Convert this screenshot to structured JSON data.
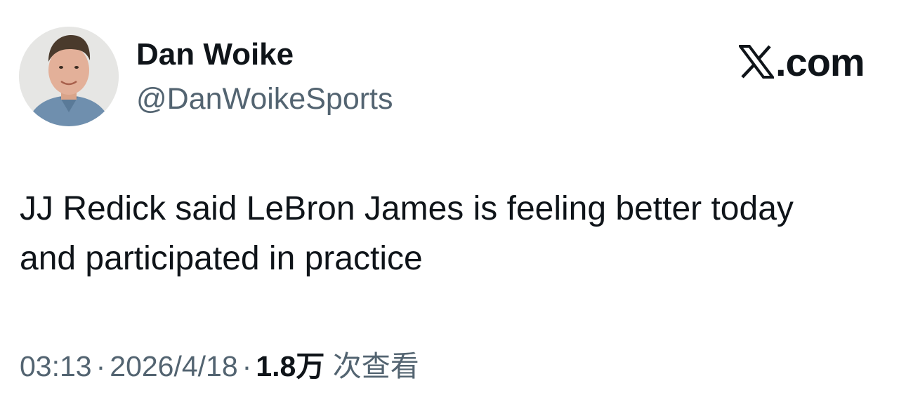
{
  "author": {
    "display_name": "Dan Woike",
    "handle": "@DanWoikeSports"
  },
  "brand": {
    "domain": ".com",
    "icon": "x-logo-icon"
  },
  "tweet": {
    "text_line_1": "JJ Redick said LeBron James is feeling better today",
    "text_line_2": "and participated in practice"
  },
  "meta": {
    "time": "03:13",
    "separator": "·",
    "date": "2026/4/18",
    "views_count": "1.8万",
    "views_label": "次查看"
  },
  "colors": {
    "text_primary": "#0f1419",
    "text_secondary": "#536471",
    "background": "#ffffff"
  }
}
